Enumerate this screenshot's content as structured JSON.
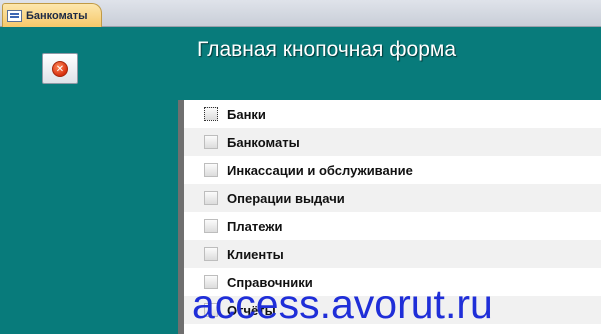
{
  "tab": {
    "title": "Банкоматы",
    "icon": "form-icon"
  },
  "form": {
    "title": "Главная кнопочная форма",
    "close_icon": "close-icon",
    "items": [
      {
        "label": "Банки"
      },
      {
        "label": "Банкоматы"
      },
      {
        "label": "Инкассации и обслуживание"
      },
      {
        "label": "Операции выдачи"
      },
      {
        "label": "Платежи"
      },
      {
        "label": "Клиенты"
      },
      {
        "label": "Справочники"
      },
      {
        "label": "Отчёты"
      }
    ],
    "background_color": "#087b7b"
  },
  "watermark": {
    "text": "access.avorut.ru",
    "color": "#1f2ed8"
  }
}
